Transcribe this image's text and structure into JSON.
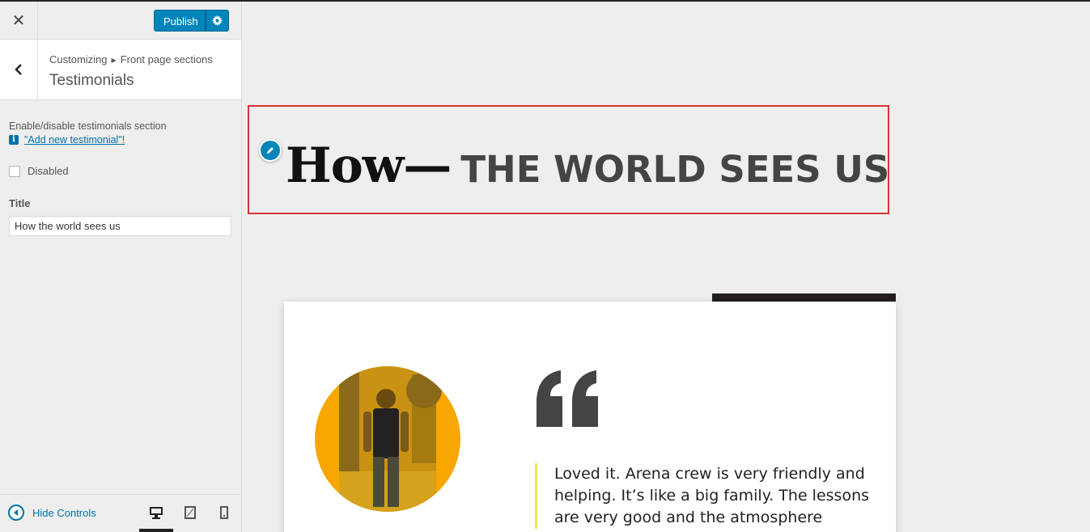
{
  "sidebar": {
    "publish_label": "Publish",
    "breadcrumb": [
      "Customizing",
      "Front page sections"
    ],
    "section_title": "Testimonials",
    "description": "Enable/disable testimonials section",
    "info_link": "\"Add new testimonial\"!",
    "checkbox_label": "Disabled",
    "checkbox_checked": false,
    "title_label": "Title",
    "title_value": "How the world sees us",
    "hide_controls": "Hide Controls",
    "devices": [
      "desktop",
      "tablet",
      "mobile"
    ],
    "active_device": "desktop"
  },
  "preview": {
    "heading_first": "How—",
    "heading_rest": "THE WORLD SEES US",
    "quote_text": "Loved it. Arena crew is very friendly and helping. It’s like a big family. The lessons are very good and the atmosphere",
    "colors": {
      "accent": "#0085ba",
      "highlight_border": "#d63638",
      "avatar_bg": "#f7a700",
      "quote_bar": "#f5e642",
      "dark_bar": "#231f20"
    }
  }
}
